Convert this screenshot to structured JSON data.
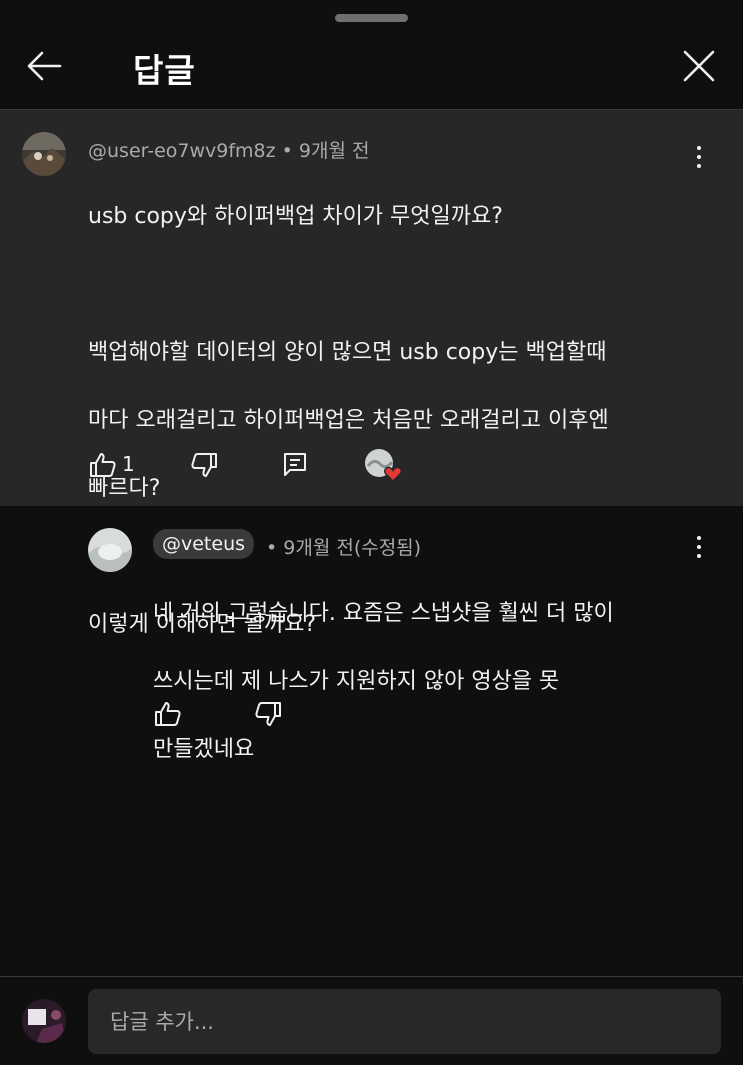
{
  "header": {
    "title": "답글"
  },
  "comment": {
    "author": "@user-eo7wv9fm8z",
    "time": "• 9개월 전",
    "lines": [
      "usb copy와 하이퍼백업 차이가 무엇일까요?",
      "",
      "백업해야할 데이터의 양이 많으면 usb copy는 백업할때",
      "마다 오래걸리고 하이퍼백업은 처음만 오래걸리고 이후엔",
      "빠르다?",
      "",
      "이렇게 이해하면 될까요?"
    ],
    "like_count": "1"
  },
  "reply": {
    "author": "@veteus",
    "time": "• 9개월 전(수정됨)",
    "lines": [
      "네 거의 그렇습니다.  요즘은 스냅샷을 훨씬 더 많이",
      "쓰시는데 제 나스가 지원하지 않아 영상을 못",
      "만들겠네요"
    ]
  },
  "composer": {
    "placeholder": "답글 추가..."
  },
  "colors": {
    "sheet_bg": "#0f0f0f",
    "highlight_bg": "#272727",
    "heart": "#e53935"
  },
  "icons": [
    "back-arrow-icon",
    "close-icon",
    "more-vert-icon",
    "thumb-up-icon",
    "thumb-down-icon",
    "reply-icon",
    "heart-icon"
  ]
}
